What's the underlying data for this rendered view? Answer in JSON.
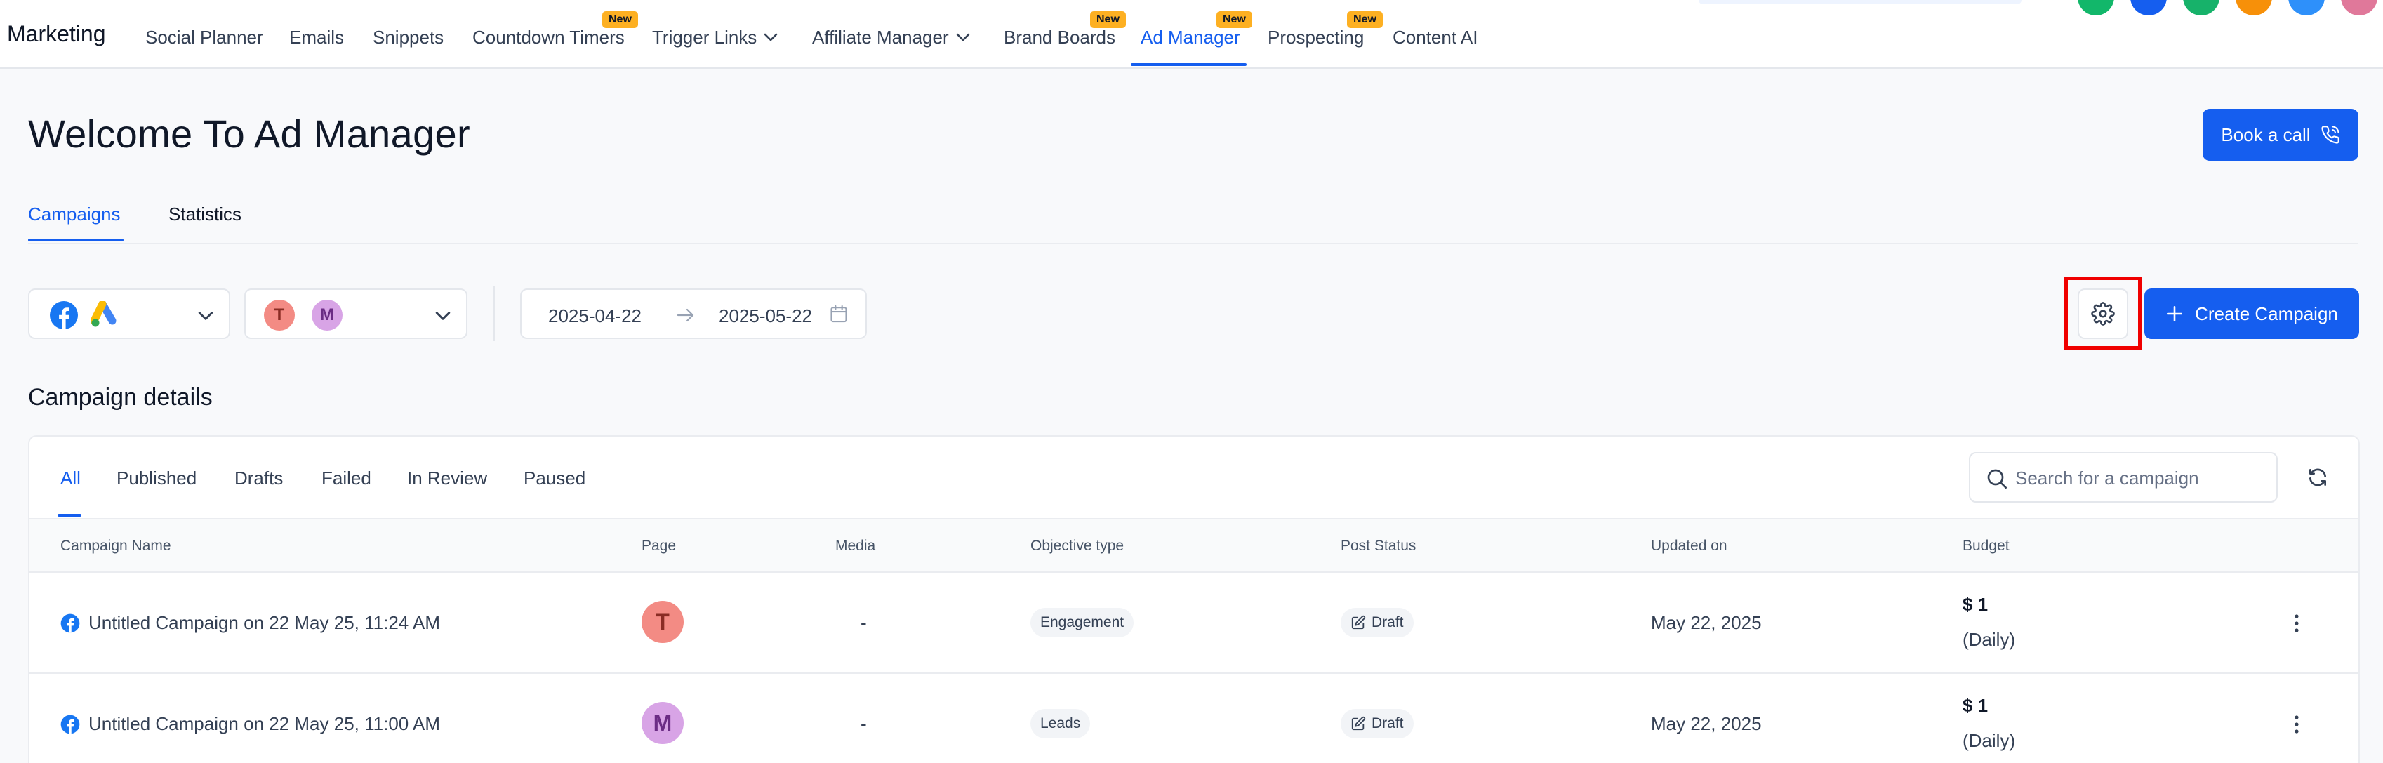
{
  "app": {
    "brand": "Marketing",
    "new_badge": "New",
    "nav": [
      {
        "label": "Social Planner"
      },
      {
        "label": "Emails"
      },
      {
        "label": "Snippets"
      },
      {
        "label": "Countdown Timers"
      },
      {
        "label": "Trigger Links"
      },
      {
        "label": "Affiliate Manager"
      },
      {
        "label": "Brand Boards"
      },
      {
        "label": "Ad Manager"
      },
      {
        "label": "Prospecting"
      },
      {
        "label": "Content AI"
      }
    ],
    "active_nav": "Ad Manager"
  },
  "header": {
    "title": "Welcome To Ad Manager",
    "book_call_label": "Book a call"
  },
  "tabs": [
    {
      "label": "Campaigns"
    },
    {
      "label": "Statistics"
    }
  ],
  "active_tab": "Campaigns",
  "filters": {
    "accounts": [
      {
        "initial": "T",
        "bg": "#f38b84",
        "fg": "#8a2c24"
      },
      {
        "initial": "M",
        "bg": "#d8a4e6",
        "fg": "#6b2c85"
      }
    ],
    "date_start": "2025-04-22",
    "date_end": "2025-05-22",
    "create_label": "Create Campaign"
  },
  "details": {
    "title": "Campaign details",
    "status_tabs": [
      {
        "label": "All"
      },
      {
        "label": "Published"
      },
      {
        "label": "Drafts"
      },
      {
        "label": "Failed"
      },
      {
        "label": "In Review"
      },
      {
        "label": "Paused"
      }
    ],
    "active_status_tab": "All",
    "search_placeholder": "Search for a campaign",
    "columns": [
      "Campaign Name",
      "Page",
      "Media",
      "Objective type",
      "Post Status",
      "Updated on",
      "Budget"
    ],
    "rows": [
      {
        "name": "Untitled Campaign on 22 May 25, 11:24 AM",
        "page_initial": "T",
        "page_bg": "#f38b84",
        "page_fg": "#8a2c24",
        "media": "-",
        "objective": "Engagement",
        "status": "Draft",
        "updated": "May 22, 2025",
        "budget": "$ 1",
        "budget_period": "(Daily)"
      },
      {
        "name": "Untitled Campaign on 22 May 25, 11:00 AM",
        "page_initial": "M",
        "page_bg": "#d8a4e6",
        "page_fg": "#6b2c85",
        "media": "-",
        "objective": "Leads",
        "status": "Draft",
        "updated": "May 22, 2025",
        "budget": "$ 1",
        "budget_period": "(Daily)"
      }
    ]
  },
  "colors": {
    "primary": "#155eef",
    "highlight": "#f00000",
    "badge": "#fdb022"
  }
}
